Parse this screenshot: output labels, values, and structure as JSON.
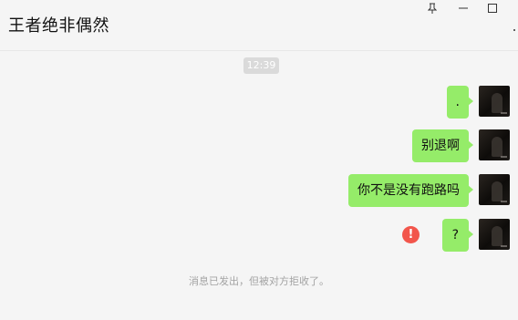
{
  "chat": {
    "title": "王者绝非偶然",
    "timestamp": "12:39",
    "messages": [
      {
        "text": ".",
        "sender": "self"
      },
      {
        "text": "别退啊",
        "sender": "self"
      },
      {
        "text": "你不是没有跑路吗",
        "sender": "self"
      },
      {
        "text": "?",
        "sender": "self",
        "failed": true
      }
    ],
    "system_notice": "消息已发出，但被对方拒收了。"
  },
  "window_controls": {
    "pin_icon": "pin-icon",
    "minimize_icon": "minimize-icon",
    "maximize_icon": "maximize-icon"
  },
  "error_icon_glyph": "!",
  "colors": {
    "bubble": "#95ec69",
    "error": "#f2554b",
    "background": "#f5f5f5"
  }
}
